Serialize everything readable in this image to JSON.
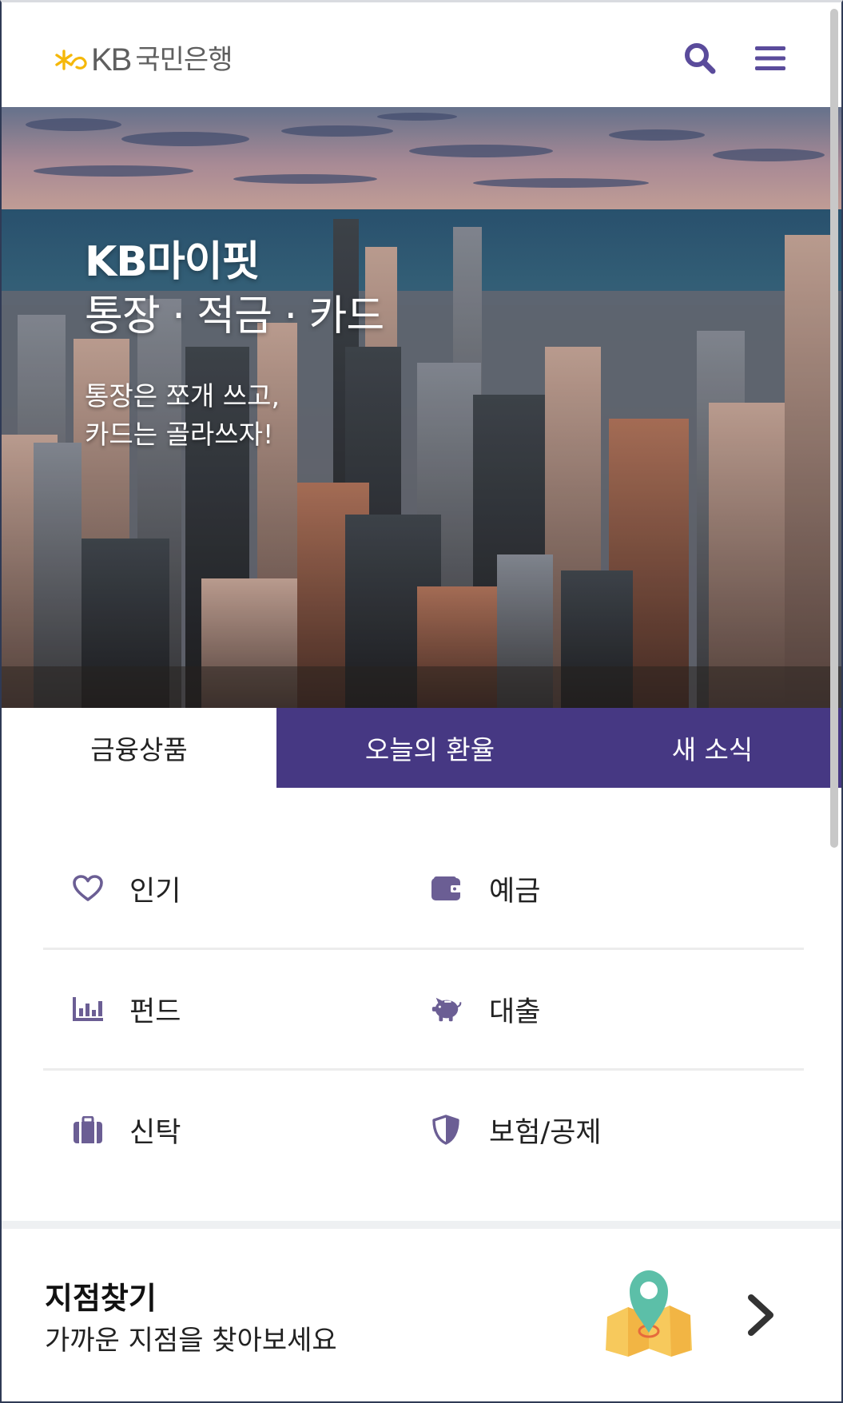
{
  "header": {
    "logo_kb": "KB",
    "logo_name": "국민은행",
    "search_icon": "search-icon",
    "menu_icon": "hamburger-menu-icon",
    "accent_color": "#5a4b9b",
    "logo_star_color": "#f5b80a"
  },
  "hero": {
    "title_line1": "KB마이핏",
    "title_line2": "통장 · 적금 · 카드",
    "subtitle_line1": "통장은 쪼개 쓰고,",
    "subtitle_line2": "카드는 골라쓰자!"
  },
  "tabs": [
    {
      "label": "금융상품",
      "active": true
    },
    {
      "label": "오늘의 환율",
      "active": false
    },
    {
      "label": "새 소식",
      "active": false
    }
  ],
  "products": [
    {
      "label": "인기",
      "icon": "heart-icon"
    },
    {
      "label": "예금",
      "icon": "wallet-icon"
    },
    {
      "label": "펀드",
      "icon": "bar-chart-icon"
    },
    {
      "label": "대출",
      "icon": "piggy-bank-icon"
    },
    {
      "label": "신탁",
      "icon": "briefcase-icon"
    },
    {
      "label": "보험/공제",
      "icon": "shield-icon"
    }
  ],
  "branch": {
    "title": "지점찾기",
    "subtitle": "가까운 지점을 찾아보세요",
    "map_icon": "map-pin-icon",
    "arrow_icon": "chevron-right-icon"
  },
  "colors": {
    "tab_inactive_bg": "#463883",
    "icon_color": "#6b5e94"
  }
}
